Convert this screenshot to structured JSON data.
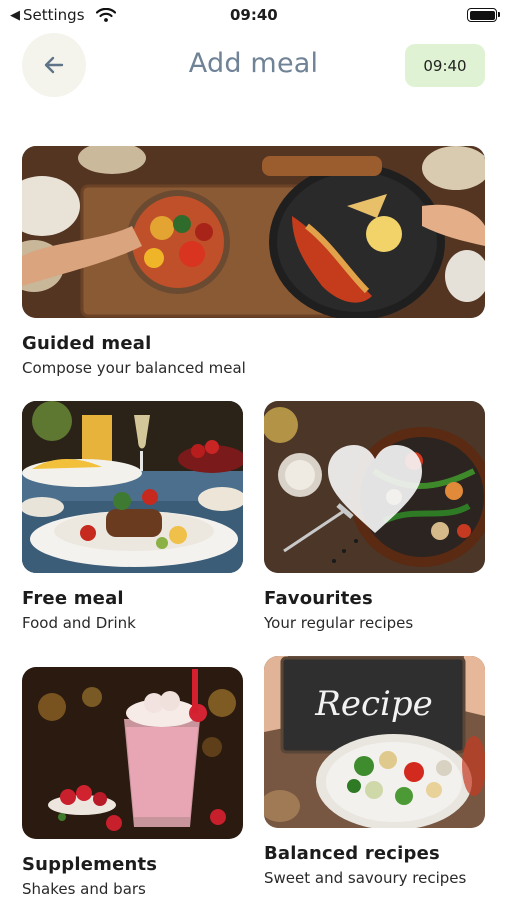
{
  "status_bar": {
    "back_label": "Settings",
    "time": "09:40"
  },
  "header": {
    "title": "Add meal",
    "time_badge": "09:40"
  },
  "cards": [
    {
      "title": "Guided meal",
      "subtitle": "Compose your balanced meal",
      "image": "grilled lobster and vegetable dish"
    },
    {
      "title": "Free meal",
      "subtitle": "Food and Drink",
      "image": "restaurant plated dish"
    },
    {
      "title": "Favourites",
      "subtitle": "Your regular recipes",
      "image": "stir fry pan with heart",
      "overlay_icon": "heart-icon"
    },
    {
      "title": "Supplements",
      "subtitle": "Shakes and bars",
      "image": "strawberry milkshake"
    },
    {
      "title": "Balanced recipes",
      "subtitle": "Sweet and savoury recipes",
      "image": "salad with recipe chalkboard",
      "board_text": "Recipe"
    }
  ]
}
